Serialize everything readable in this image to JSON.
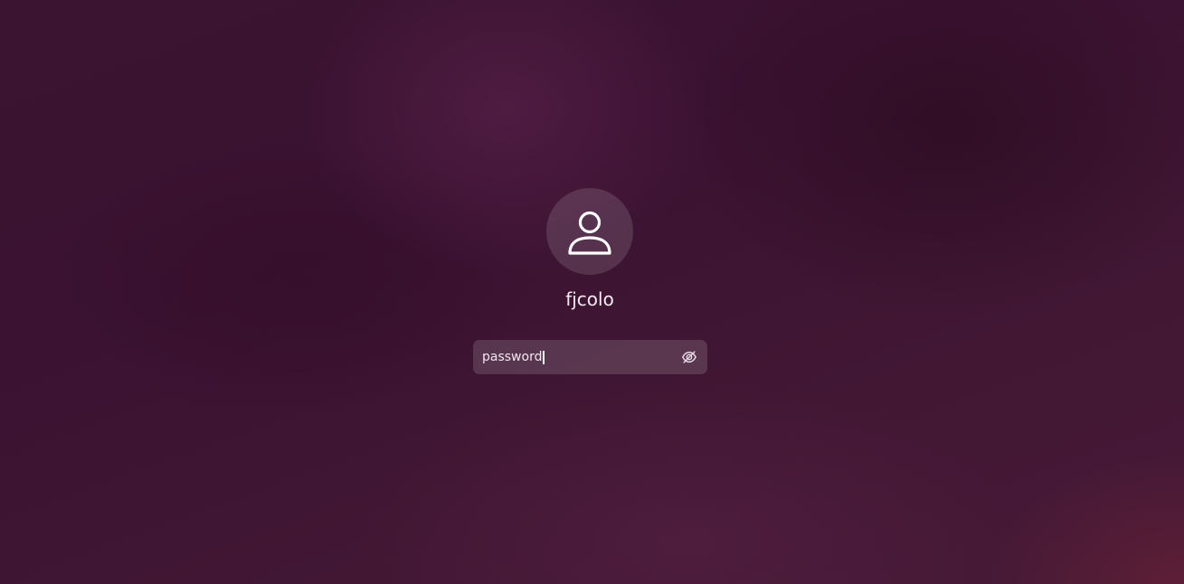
{
  "screen": {
    "type": "login"
  },
  "user": {
    "avatar_icon": "user-silhouette-icon",
    "name": "fjcolo"
  },
  "password_field": {
    "value": "password",
    "reveal_icon": "eye-slash-icon"
  },
  "colors": {
    "background": "#3b1232",
    "text": "#f2eaf0",
    "field_background": "rgba(255,255,255,0.14)"
  }
}
